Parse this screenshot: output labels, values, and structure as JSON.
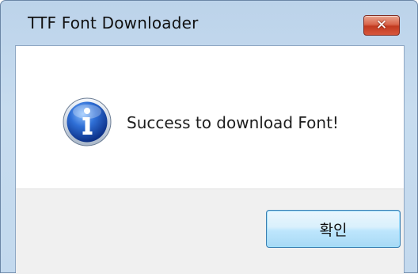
{
  "window": {
    "title": "TTF Font Downloader",
    "close_glyph": "✕",
    "close_icon": "close-icon"
  },
  "dialog": {
    "icon": "information-icon",
    "message": "Success to download Font!",
    "ok_label": "확인"
  },
  "colors": {
    "close_button": "#c84a30",
    "ok_button_border": "#3c7fb1",
    "info_icon": "#1c4fb0",
    "button_area": "#f0f0f0"
  }
}
